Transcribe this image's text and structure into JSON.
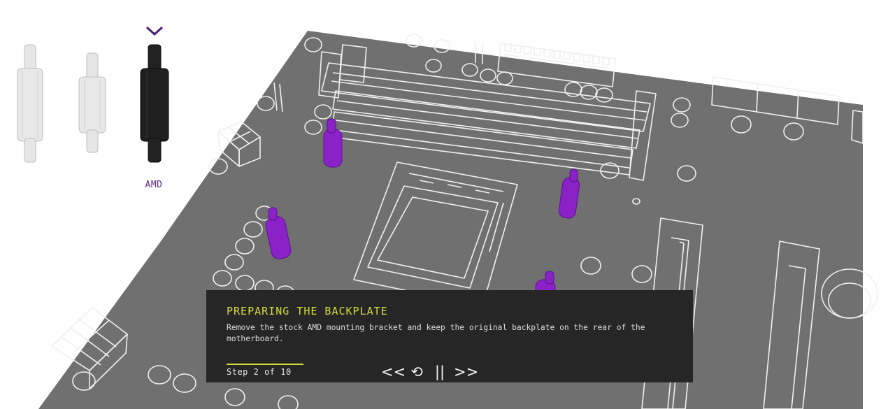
{
  "standoff_picker": {
    "options": [
      {
        "label": "",
        "color": "#e4e4e4"
      },
      {
        "label": "",
        "color": "#e4e4e4"
      },
      {
        "label": "AMD",
        "color": "#1f1f1f",
        "selected": true
      }
    ],
    "selected_label": "AMD",
    "accent": "#4b1a7a"
  },
  "panel": {
    "title": "PREPARING THE BACKPLATE",
    "description": "Remove the stock AMD mounting bracket and keep the original backplate on the rear of the motherboard.",
    "step_text": "Step 2 of 10",
    "step_current": 2,
    "step_total": 10,
    "controls": {
      "prev": "<<",
      "replay": "⟲",
      "pause": "||",
      "next": ">>"
    }
  },
  "colors": {
    "board": "#707070",
    "board_lines": "#f0f0f0",
    "highlight": "#8a22c8",
    "panel_bg": "#262626",
    "accent_yellow": "#d7dc3c"
  },
  "icons": [
    "chevron-down-icon",
    "replay-icon",
    "pause-icon",
    "previous-icon",
    "next-icon"
  ]
}
